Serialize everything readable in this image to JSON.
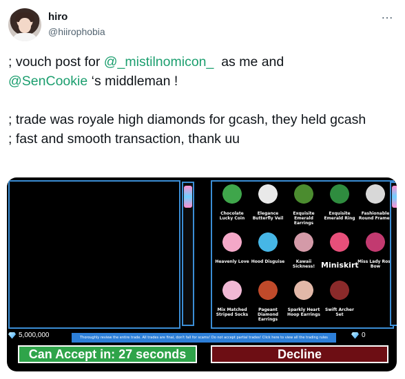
{
  "author": {
    "display_name": "hiro",
    "handle": "@hiirophobia"
  },
  "more_icon": "…",
  "tweet": {
    "line1_pre": "; vouch post for ",
    "line1_mention": "@_mistilnomicon_",
    "line1_post": "  as me and",
    "line2_mention": "@SenCookie",
    "line2_post": " ‘s middleman !",
    "line3": "; trade was royale high diamonds for gcash, they held gcash",
    "line4": "; fast and smooth transaction, thank uu"
  },
  "trade": {
    "items": [
      {
        "label": "Chocolate Lucky Coin",
        "color": "#3fa64b"
      },
      {
        "label": "Elegance Butterfly Veil",
        "color": "#e9e9e9"
      },
      {
        "label": "Exquisite Emerald Earrings",
        "color": "#4b8c2f"
      },
      {
        "label": "Exquisite Emerald Ring",
        "color": "#2f8c3f"
      },
      {
        "label": "Fashionable Round Frames",
        "color": "#d8d8d8"
      },
      {
        "label": "Heavenly Love",
        "color": "#f4a8c8"
      },
      {
        "label": "Hood Disguise",
        "color": "#46b6e6"
      },
      {
        "label": "Kawaii Sickness!",
        "color": "#d49aa8"
      },
      {
        "label": "Miniskirt",
        "color": "#e74f7a",
        "big": true
      },
      {
        "label": "Miss Lady Rose Bow",
        "color": "#c23a70"
      },
      {
        "label": "Mix Matched Striped Socks",
        "color": "#f0b8d4"
      },
      {
        "label": "Pageant Diamond Earrings",
        "color": "#c04a2a"
      },
      {
        "label": "Sparkly Heart Hoop Earrings",
        "color": "#e2b8a8"
      },
      {
        "label": "Swift Archer Set",
        "color": "#8a2a2a"
      }
    ],
    "left_diamonds": "5,000,000",
    "right_diamonds": "0",
    "notice": "Thoroughly review the entire trade. All trades are final, don't fall for scams! Do not accept partial trades! Click here to view all the trading rules",
    "accept_label": "Can Accept in: 27 seconds",
    "decline_label": "Decline",
    "accent": "#3b8ed6",
    "accept_color": "#2fa44a",
    "decline_color": "#6d0e14"
  }
}
